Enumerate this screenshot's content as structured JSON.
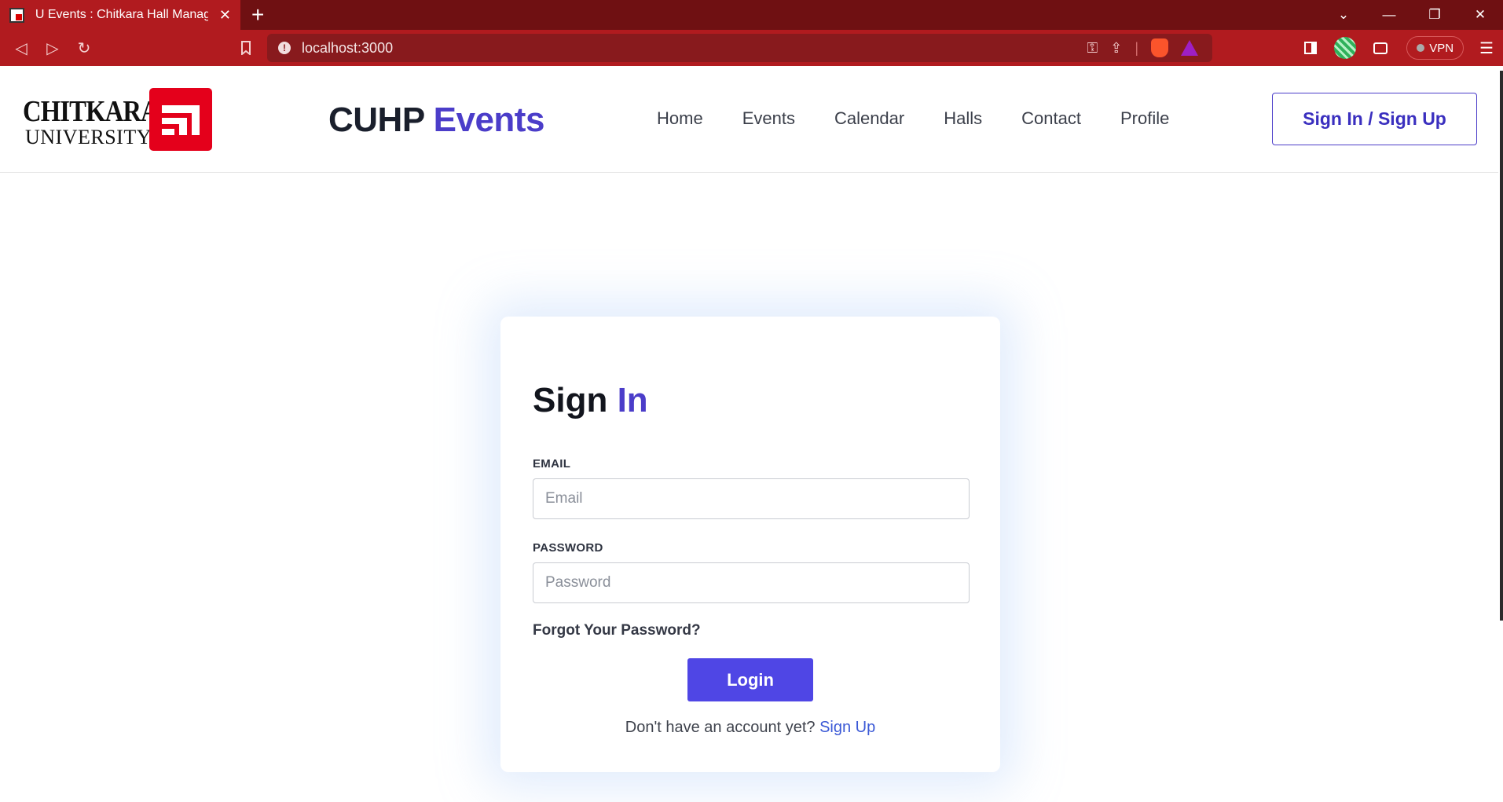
{
  "browser": {
    "tab_title": "U Events : Chitkara Hall Managem",
    "url": "localhost:3000",
    "vpn_label": "VPN"
  },
  "icons": {
    "back": "back-icon",
    "forward": "forward-icon",
    "reload": "reload-icon",
    "bookmark": "bookmark-icon",
    "site_info": "info-icon",
    "key": "key-icon",
    "share": "share-icon",
    "brave": "brave-shield-icon",
    "bat": "bat-rewards-icon",
    "menu": "hamburger-menu-icon"
  },
  "header": {
    "logo_line1": "CHITKARA",
    "logo_line2": "UNIVERSITY",
    "brand_main": "CUHP",
    "brand_accent": "Events",
    "nav": [
      "Home",
      "Events",
      "Calendar",
      "Halls",
      "Contact",
      "Profile"
    ],
    "auth_button": "Sign In / Sign Up"
  },
  "login": {
    "title_main": "Sign",
    "title_accent": "In",
    "email_label": "EMAIL",
    "email_placeholder": "Email",
    "password_label": "PASSWORD",
    "password_placeholder": "Password",
    "forgot": "Forgot Your Password?",
    "login_button": "Login",
    "no_account": "Don't have an account yet?",
    "signup_link": "Sign Up"
  },
  "colors": {
    "browser_chrome": "#b11b1f",
    "accent": "#4b3dc9",
    "button": "#4f46e5",
    "logo_red": "#e4001b"
  }
}
